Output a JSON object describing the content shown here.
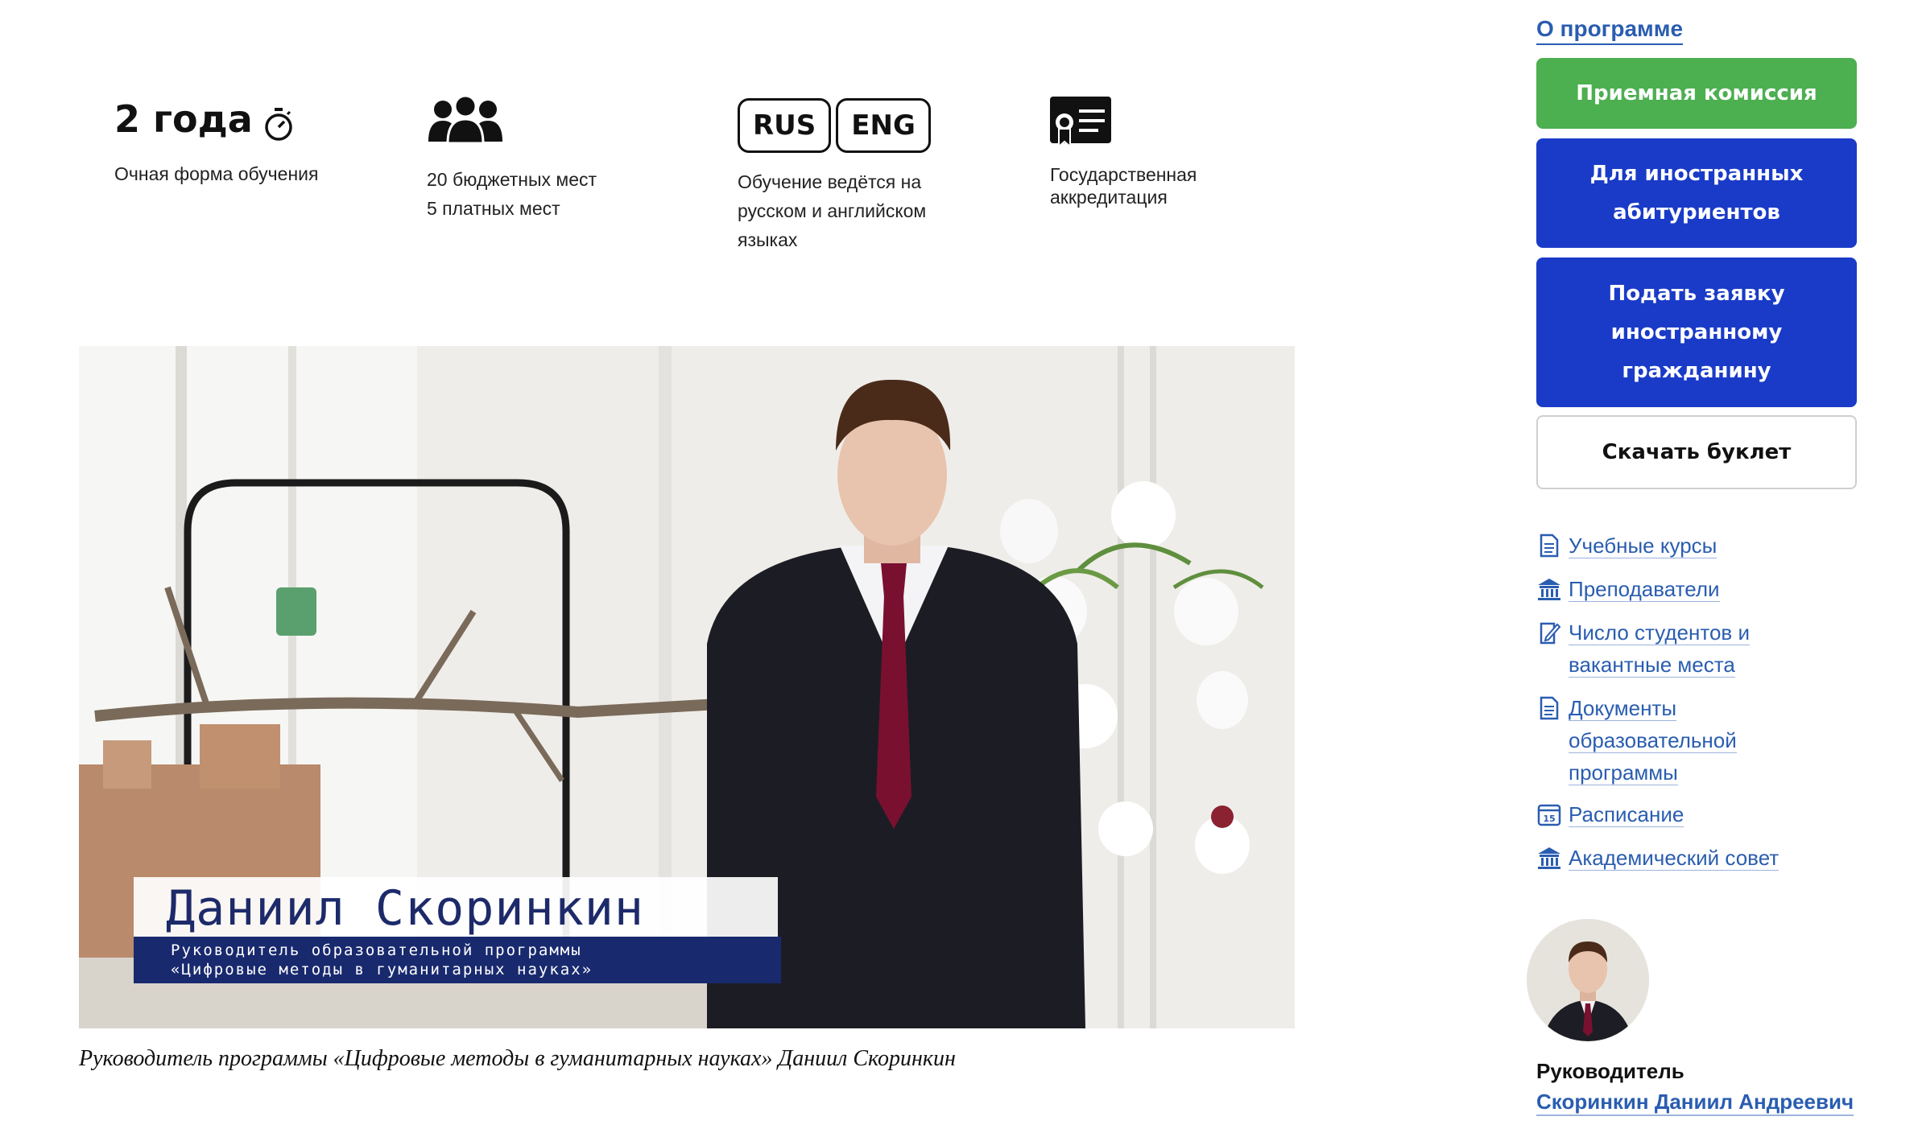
{
  "facts": {
    "duration": {
      "value": "2 года",
      "text": "Очная форма обучения",
      "icon": "stopwatch-icon"
    },
    "places": {
      "line1": "20 бюджетных мест",
      "line2": "5 платных мест",
      "icon": "people-icon"
    },
    "language": {
      "badge1": "RUS",
      "badge2": "ENG",
      "line1": "Обучение ведётся на",
      "line2": "русском и английском",
      "line3": "языках"
    },
    "accreditation": {
      "line1": "Государственная",
      "line2": "аккредитация",
      "icon": "certificate-icon"
    }
  },
  "video": {
    "name_overlay": "Даниил Скоринкин",
    "role_line1": "Руководитель образовательной программы",
    "role_line2": "«Цифровые методы в гуманитарных науках»",
    "caption": "Руководитель программы «Цифровые методы в гуманитарных науках» Даниил Скоринкин"
  },
  "sidebar": {
    "about": "О программе",
    "buttons": {
      "admission": "Приемная комиссия",
      "foreign_1": "Для иностранных",
      "foreign_2": "абитуриентов",
      "apply_1": "Подать заявку",
      "apply_2": "иностранному",
      "apply_3": "гражданину",
      "booklet": "Скачать буклет"
    },
    "links": {
      "courses": "Учебные курсы",
      "teachers": "Преподаватели",
      "students_1": "Число студентов и",
      "students_2": "вакантные места",
      "docs_1": "Документы",
      "docs_2": "образовательной",
      "docs_3": "программы",
      "schedule": "Расписание",
      "council": "Академический совет"
    },
    "head": {
      "title": "Руководитель",
      "name": "Скоринкин Даниил Андреевич"
    }
  },
  "colors": {
    "green": "#4caf50",
    "blue": "#1a3bc8",
    "link": "#2a5db0",
    "plate": "#18296e"
  }
}
